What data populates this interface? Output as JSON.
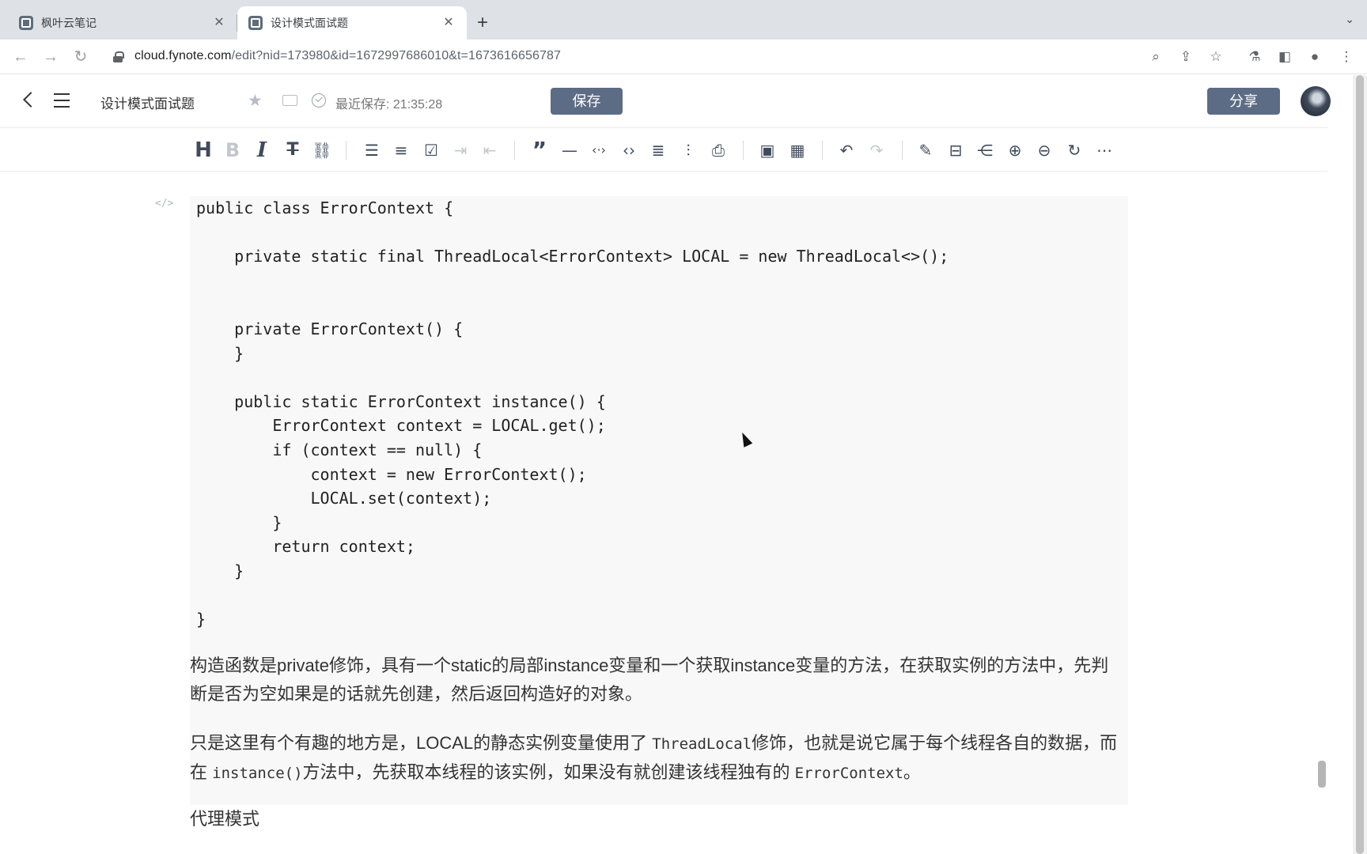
{
  "browser": {
    "tabs": [
      {
        "title": "枫叶云笔记",
        "active": false
      },
      {
        "title": "设计模式面试题",
        "active": true
      }
    ],
    "new_tab": "+",
    "tab_menu": "⌄",
    "url_host": "cloud.fynote.com",
    "url_path": "/edit?nid=173980&id=1672997686010&t=1673616656787"
  },
  "header": {
    "title": "设计模式面试题",
    "save_status": "最近保存: 21:35:28",
    "save_label": "保存",
    "share_label": "分享"
  },
  "toolbar": {
    "groups": [
      [
        "heading-icon",
        "bold-icon",
        "italic-icon",
        "strikethrough-icon",
        "link-icon"
      ],
      [
        "bullet-list-icon",
        "numbered-list-icon",
        "checklist-icon",
        "indent-icon",
        "outdent-icon"
      ],
      [
        "quote-icon",
        "horizontal-rule-icon",
        "inline-code-icon",
        "code-block-icon",
        "table-of-contents-icon",
        "text-align-icon",
        "print-icon"
      ],
      [
        "image-icon",
        "table-icon"
      ],
      [
        "undo-icon",
        "redo-icon"
      ],
      [
        "edit-icon",
        "outline-icon",
        "mindmap-icon",
        "zoom-in-icon",
        "zoom-out-icon",
        "refresh-icon",
        "more-icon"
      ]
    ]
  },
  "editor": {
    "code_marker": "</>",
    "code": "public class ErrorContext {\n\n    private static final ThreadLocal<ErrorContext> LOCAL = new ThreadLocal<>();\n\n\n    private ErrorContext() {\n    }\n\n    public static ErrorContext instance() {\n        ErrorContext context = LOCAL.get();\n        if (context == null) {\n            context = new ErrorContext();\n            LOCAL.set(context);\n        }\n        return context;\n    }\n\n}",
    "paragraph1": "构造函数是private修饰，具有一个static的局部instance变量和一个获取instance变量的方法，在获取实例的方法中，先判断是否为空如果是的话就先创建，然后返回构造好的对象。",
    "paragraph2": {
      "part1": "只是这里有个有趣的地方是，LOCAL的静态实例变量使用了 ",
      "code1": "ThreadLocal",
      "part2": "修饰，也就是说它属于每个线程各自的数据，而在 ",
      "code2": "instance()",
      "part3": "方法中，先获取本线程的该实例，如果没有就创建该线程独有的 ",
      "code3": "ErrorContext",
      "part4": "。"
    },
    "heading": "代理模式"
  }
}
